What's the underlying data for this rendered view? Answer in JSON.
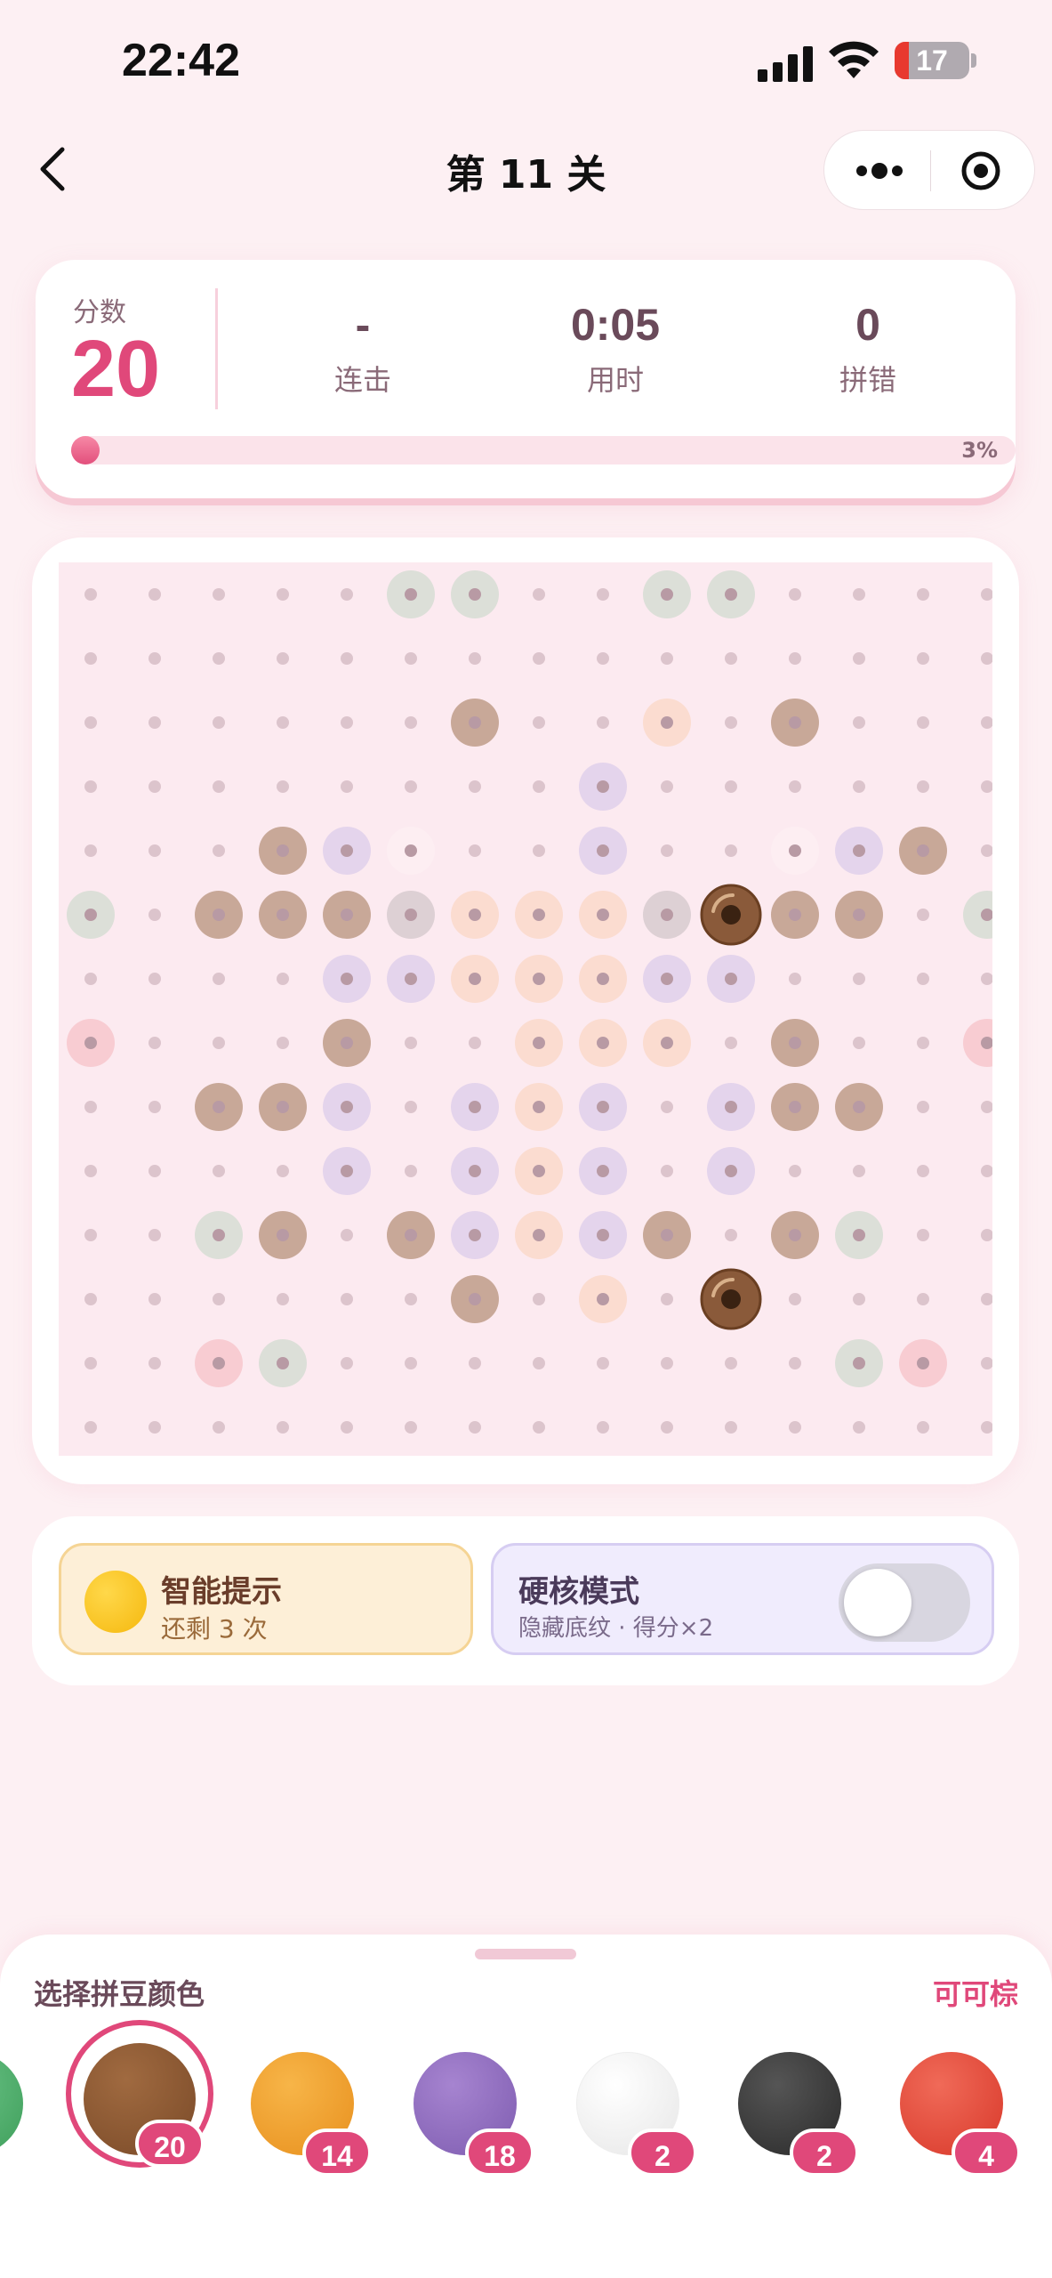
{
  "status_bar": {
    "time": "22:42",
    "battery": "17"
  },
  "nav": {
    "title": "第 11 关"
  },
  "score": {
    "label": "分数",
    "value": "20",
    "stats": [
      {
        "value": "-",
        "label": "连击"
      },
      {
        "value": "0:05",
        "label": "用时"
      },
      {
        "value": "0",
        "label": "拼错"
      }
    ],
    "progress": 0.03,
    "progress_text": "3%"
  },
  "colors": {
    "accent": "#e0487a",
    "brown": "#8a5a3a",
    "orange": "#f0a030",
    "purple": "#8e6bc0",
    "white": "#f5f5f5",
    "black": "#333333",
    "red": "#e04a3a",
    "green": "#4caf6a"
  },
  "board": {
    "cols": 15,
    "rows": 14,
    "legend": {
      ".": "empty",
      "b": "brown-hint",
      "p": "purple-hint",
      "o": "peach-hint",
      "g": "green-hint",
      "r": "pink-hint",
      "s": "grey-hint",
      "w": "white-hint",
      "B": "brown-placed"
    },
    "grid": [
      ".....gg..gg....",
      "...............",
      "......b..o.b...",
      "........p......",
      "...bpw..p..wpb.",
      "g.bbbsooosBbb.g",
      "....ppooopp....",
      "r...b..ooo.b..r",
      "..bbp.pop.pbb..",
      "....p.pop.p....",
      "..gb.bpopb.bg..",
      "......b.o.B....",
      "..rg........gr.",
      "..............."
    ]
  },
  "tools": {
    "hint": {
      "title": "智能提示",
      "subtitle": "还剩 3 次"
    },
    "hardcore": {
      "title": "硬核模式",
      "subtitle": "隐藏底纹 · 得分×2",
      "enabled": false
    }
  },
  "palette": {
    "title": "选择拼豆颜色",
    "selected_name": "可可棕",
    "swatches": [
      {
        "color": "brown",
        "count": "20",
        "selected": true
      },
      {
        "color": "orange",
        "count": "14",
        "selected": false
      },
      {
        "color": "purple",
        "count": "18",
        "selected": false
      },
      {
        "color": "white",
        "count": "2",
        "selected": false
      },
      {
        "color": "black",
        "count": "2",
        "selected": false
      },
      {
        "color": "red",
        "count": "4",
        "selected": false
      }
    ]
  }
}
